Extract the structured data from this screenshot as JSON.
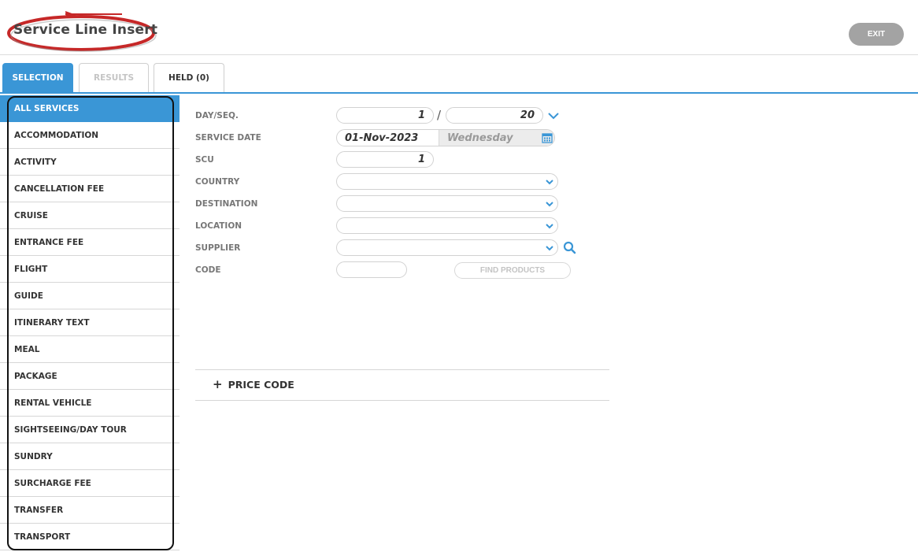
{
  "header": {
    "title": "Service Line Insert",
    "exit_label": "EXIT"
  },
  "tabs": [
    {
      "label": "SELECTION",
      "state": "active"
    },
    {
      "label": "RESULTS",
      "state": "disabled"
    },
    {
      "label": "HELD (0)",
      "state": "normal"
    }
  ],
  "sidebar": {
    "items": [
      {
        "label": "ALL SERVICES"
      },
      {
        "label": "ACCOMMODATION"
      },
      {
        "label": "ACTIVITY"
      },
      {
        "label": "CANCELLATION FEE"
      },
      {
        "label": "CRUISE"
      },
      {
        "label": "ENTRANCE FEE"
      },
      {
        "label": "FLIGHT"
      },
      {
        "label": "GUIDE"
      },
      {
        "label": "ITINERARY TEXT"
      },
      {
        "label": "MEAL"
      },
      {
        "label": "PACKAGE"
      },
      {
        "label": "RENTAL VEHICLE"
      },
      {
        "label": "SIGHTSEEING/DAY TOUR"
      },
      {
        "label": "SUNDRY"
      },
      {
        "label": "SURCHARGE FEE"
      },
      {
        "label": "TRANSFER"
      },
      {
        "label": "TRANSPORT"
      }
    ],
    "selected": "ALL SERVICES"
  },
  "form": {
    "day_seq": {
      "label": "DAY/SEQ.",
      "day": "1",
      "separator": "/",
      "seq": "20"
    },
    "service_date": {
      "label": "SERVICE DATE",
      "date": "01-Nov-2023",
      "weekday": "Wednesday"
    },
    "scu": {
      "label": "SCU",
      "value": "1"
    },
    "country": {
      "label": "COUNTRY",
      "value": ""
    },
    "destination": {
      "label": "DESTINATION",
      "value": ""
    },
    "location": {
      "label": "LOCATION",
      "value": ""
    },
    "supplier": {
      "label": "SUPPLIER",
      "value": ""
    },
    "code": {
      "label": "CODE",
      "value": ""
    },
    "find_products_label": "FIND PRODUCTS"
  },
  "price_code": {
    "plus": "+",
    "label": "PRICE CODE"
  },
  "colors": {
    "accent": "#3a96d6",
    "exit_button": "#a3a3a3",
    "annotation_red": "#c62828"
  }
}
